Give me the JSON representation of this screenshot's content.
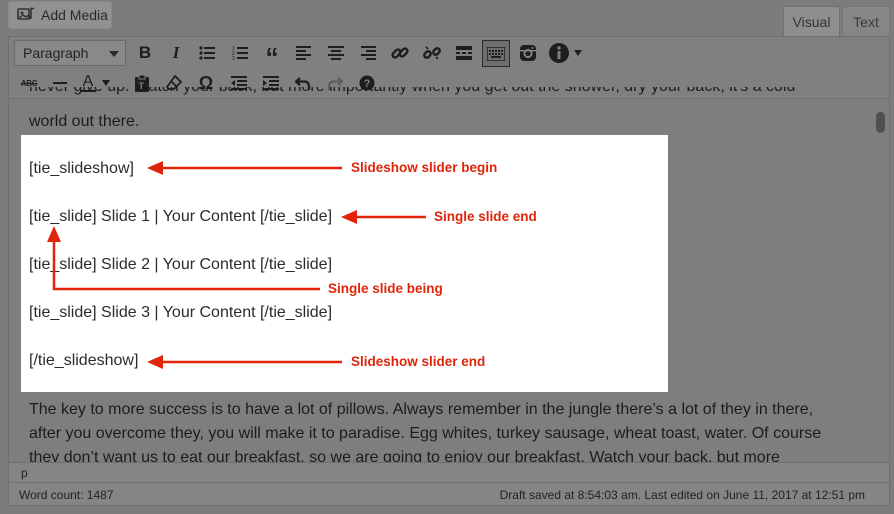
{
  "header": {
    "add_media_label": "Add Media"
  },
  "tabs": {
    "visual": "Visual",
    "text": "Text"
  },
  "toolbar": {
    "format_value": "Paragraph",
    "row1_icons": [
      "bold-icon",
      "italic-icon",
      "bulleted-list-icon",
      "numbered-list-icon",
      "blockquote-icon",
      "align-left-icon",
      "align-center-icon",
      "align-right-icon",
      "insert-link-icon",
      "remove-link-icon",
      "read-more-icon",
      "toolbar-toggle-icon",
      "instagram-icon",
      "info-icon"
    ],
    "row2_icons": [
      "strikethrough-icon",
      "horizontal-line-icon",
      "text-color-icon",
      "paste-as-text-icon",
      "clear-formatting-icon",
      "special-character-icon",
      "decrease-indent-icon",
      "increase-indent-icon",
      "undo-icon",
      "redo-icon",
      "keyboard-shortcuts-icon"
    ]
  },
  "content": {
    "top_line_partial": "never give up. Watch your back, but more importantly when you get out the shower, dry your back, it's a cold",
    "top_line": "world out there.",
    "shortcodes": [
      "[tie_slideshow]",
      "[tie_slide] Slide 1 | Your Content [/tie_slide]",
      "[tie_slide] Slide 2 | Your Content [/tie_slide]",
      "[tie_slide] Slide 3 | Your Content [/tie_slide]",
      "[/tie_slideshow]"
    ],
    "annotations": {
      "slideshow_begin": "Slideshow slider begin",
      "single_slide_end": "Single slide end",
      "single_slide_begin": "Single slide being",
      "slideshow_end": "Slideshow slider end"
    },
    "paragraph_lines": [
      "The key to more success is to have a lot of pillows. Always remember in the jungle there’s a lot of they in there,",
      "after you overcome they, you will make it to paradise. Egg whites, turkey sausage, wheat toast, water. Of course",
      "they don’t want us to eat our breakfast, so we are going to enjoy our breakfast. Watch your back, but more"
    ],
    "annotation_color": "#e0250b"
  },
  "path": {
    "current_element": "p"
  },
  "status": {
    "word_count": "Word count: 1487",
    "saved": "Draft saved at 8:54:03 am. Last edited on June 11, 2017 at 12:51 pm"
  }
}
